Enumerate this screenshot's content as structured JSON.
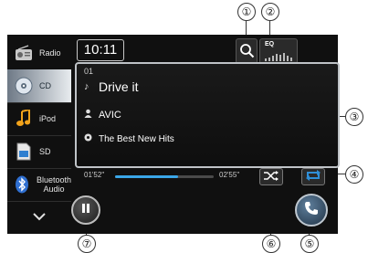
{
  "callouts": [
    "①",
    "②",
    "③",
    "④",
    "⑤",
    "⑥",
    "⑦"
  ],
  "status": {
    "clock": "10:11"
  },
  "sidebar": {
    "items": [
      {
        "label": "Radio",
        "icon": "radio-icon"
      },
      {
        "label": "CD",
        "icon": "cd-icon",
        "active": true
      },
      {
        "label": "iPod",
        "icon": "ipod-music-note-icon"
      },
      {
        "label": "SD",
        "icon": "sd-card-icon"
      },
      {
        "label": "Bluetooth\nAudio",
        "icon": "bluetooth-icon"
      }
    ],
    "more_icon": "chevron-down-icon"
  },
  "header": {
    "search_icon": "search-icon",
    "eq_label": "EQ"
  },
  "track": {
    "number": "01",
    "title": "Drive it",
    "artist": "AVIC",
    "album": "The Best New Hits"
  },
  "playback": {
    "elapsed": "01'52\"",
    "total": "02'55\"",
    "progress_fraction": 0.64,
    "state": "playing"
  },
  "colors": {
    "accent": "#3aa6e8",
    "repeat": "#2f8fd8"
  }
}
